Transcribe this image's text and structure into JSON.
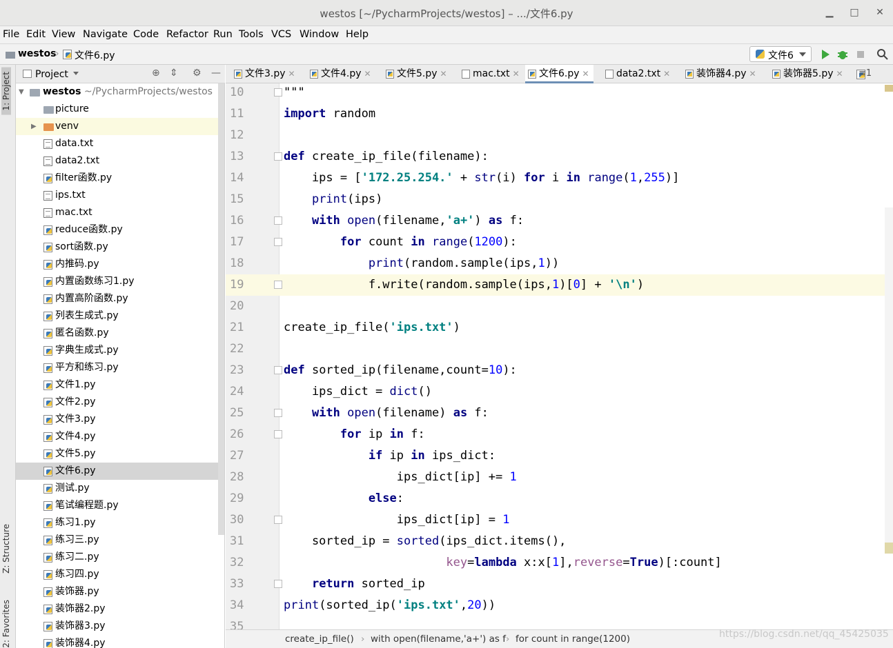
{
  "window": {
    "title": "westos [~/PycharmProjects/westos] – .../文件6.py"
  },
  "menu": {
    "items": [
      {
        "label": "File"
      },
      {
        "label": "Edit"
      },
      {
        "label": "View"
      },
      {
        "label": "Navigate"
      },
      {
        "label": "Code"
      },
      {
        "label": "Refactor"
      },
      {
        "label": "Run"
      },
      {
        "label": "Tools"
      },
      {
        "label": "VCS"
      },
      {
        "label": "Window"
      },
      {
        "label": "Help"
      }
    ]
  },
  "nav": {
    "project": "westos",
    "file": "文件6.py",
    "run_config": "文件6"
  },
  "sidebar": {
    "tabs": {
      "project": "1: Project",
      "structure": "Z: Structure",
      "favorites": "2: Favorites"
    },
    "header": "Project",
    "root": {
      "name": "westos",
      "path": "~/PycharmProjects/westos"
    },
    "items": [
      {
        "name": "picture",
        "type": "dir"
      },
      {
        "name": "venv",
        "type": "vdir"
      },
      {
        "name": "data.txt",
        "type": "txt"
      },
      {
        "name": "data2.txt",
        "type": "txt"
      },
      {
        "name": "filter函数.py",
        "type": "py"
      },
      {
        "name": "ips.txt",
        "type": "txt"
      },
      {
        "name": "mac.txt",
        "type": "txt"
      },
      {
        "name": "reduce函数.py",
        "type": "py"
      },
      {
        "name": "sort函数.py",
        "type": "py"
      },
      {
        "name": "内推码.py",
        "type": "py"
      },
      {
        "name": "内置函数练习1.py",
        "type": "py"
      },
      {
        "name": "内置高阶函数.py",
        "type": "py"
      },
      {
        "name": "列表生成式.py",
        "type": "py"
      },
      {
        "name": "匿名函数.py",
        "type": "py"
      },
      {
        "name": "字典生成式.py",
        "type": "py"
      },
      {
        "name": "平方和练习.py",
        "type": "py"
      },
      {
        "name": "文件1.py",
        "type": "py"
      },
      {
        "name": "文件2.py",
        "type": "py"
      },
      {
        "name": "文件3.py",
        "type": "py"
      },
      {
        "name": "文件4.py",
        "type": "py"
      },
      {
        "name": "文件5.py",
        "type": "py"
      },
      {
        "name": "文件6.py",
        "type": "py"
      },
      {
        "name": "测试.py",
        "type": "py"
      },
      {
        "name": "笔试编程题.py",
        "type": "py"
      },
      {
        "name": "练习1.py",
        "type": "py"
      },
      {
        "name": "练习三.py",
        "type": "py"
      },
      {
        "name": "练习二.py",
        "type": "py"
      },
      {
        "name": "练习四.py",
        "type": "py"
      },
      {
        "name": "装饰器.py",
        "type": "py"
      },
      {
        "name": "装饰器2.py",
        "type": "py"
      },
      {
        "name": "装饰器3.py",
        "type": "py"
      },
      {
        "name": "装饰器4.py",
        "type": "py"
      }
    ]
  },
  "tabs": [
    {
      "label": "文件3.py",
      "type": "py"
    },
    {
      "label": "文件4.py",
      "type": "py"
    },
    {
      "label": "文件5.py",
      "type": "py"
    },
    {
      "label": "mac.txt",
      "type": "txt"
    },
    {
      "label": "文件6.py",
      "type": "py",
      "active": true
    },
    {
      "label": "data2.txt",
      "type": "txt"
    },
    {
      "label": "装饰器4.py",
      "type": "py"
    },
    {
      "label": "装饰器5.py",
      "type": "py"
    }
  ],
  "tab_overflow": "≡1",
  "editor": {
    "lines": [
      {
        "n": "10",
        "html": "\"\"\""
      },
      {
        "n": "11",
        "html": "<span class=\"k\">import</span> random"
      },
      {
        "n": "12",
        "html": ""
      },
      {
        "n": "13",
        "html": "<span class=\"k\">def</span> create_ip_file(filename):"
      },
      {
        "n": "14",
        "html": "    ips = [<span class=\"s\">'172.25.254.'</span> + <span class=\"b\">str</span>(i) <span class=\"k\">for</span> i <span class=\"k\">in</span> <span class=\"b\">range</span>(<span class=\"n\">1</span>,<span class=\"n\">255</span>)]"
      },
      {
        "n": "15",
        "html": "    <span class=\"b\">print</span>(ips)"
      },
      {
        "n": "16",
        "html": "    <span class=\"k\">with</span> <span class=\"b\">open</span>(filename,<span class=\"s\">'a+'</span>) <span class=\"k\">as</span> f:"
      },
      {
        "n": "17",
        "html": "        <span class=\"k\">for</span> count <span class=\"k\">in</span> <span class=\"b\">range</span>(<span class=\"n\">1200</span>):"
      },
      {
        "n": "18",
        "html": "            <span class=\"b\">print</span>(random.sample(ips,<span class=\"n\">1</span>))"
      },
      {
        "n": "19",
        "html": "            f.write(random.sample(ips,<span class=\"n\">1</span>)[<span class=\"n\">0</span>] + <span class=\"s\">'\\n'</span>)"
      },
      {
        "n": "20",
        "html": ""
      },
      {
        "n": "21",
        "html": "create_ip_file(<span class=\"s\">'ips.txt'</span>)"
      },
      {
        "n": "22",
        "html": ""
      },
      {
        "n": "23",
        "html": "<span class=\"k\">def</span> sorted_ip(filename,count=<span class=\"n\">10</span>):"
      },
      {
        "n": "24",
        "html": "    ips_dict = <span class=\"b\">dict</span>()"
      },
      {
        "n": "25",
        "html": "    <span class=\"k\">with</span> <span class=\"b\">open</span>(filename) <span class=\"k\">as</span> f:"
      },
      {
        "n": "26",
        "html": "        <span class=\"k\">for</span> ip <span class=\"k\">in</span> f:"
      },
      {
        "n": "27",
        "html": "            <span class=\"k\">if</span> ip <span class=\"k\">in</span> ips_dict:"
      },
      {
        "n": "28",
        "html": "                ips_dict[ip] += <span class=\"n\">1</span>"
      },
      {
        "n": "29",
        "html": "            <span class=\"k\">else</span>:"
      },
      {
        "n": "30",
        "html": "                ips_dict[ip] = <span class=\"n\">1</span>"
      },
      {
        "n": "31",
        "html": "    sorted_ip = <span class=\"b\">sorted</span>(ips_dict.items(),"
      },
      {
        "n": "32",
        "html": "                       <span class=\"p\">key</span>=<span class=\"k\">lambda</span> x:x[<span class=\"n\">1</span>],<span class=\"p\">reverse</span>=<span class=\"k\">True</span>)[:count]"
      },
      {
        "n": "33",
        "html": "    <span class=\"k\">return</span> sorted_ip"
      },
      {
        "n": "34",
        "html": "<span class=\"b\">print</span>(sorted_ip(<span class=\"s\">'ips.txt'</span>,<span class=\"n\">20</span>))"
      },
      {
        "n": "35",
        "html": ""
      }
    ]
  },
  "status": {
    "crumbs": [
      "create_ip_file()",
      "with open(filename,'a+') as f",
      "for count in range(1200)"
    ],
    "watermark": "https://blog.csdn.net/qq_45425035"
  }
}
